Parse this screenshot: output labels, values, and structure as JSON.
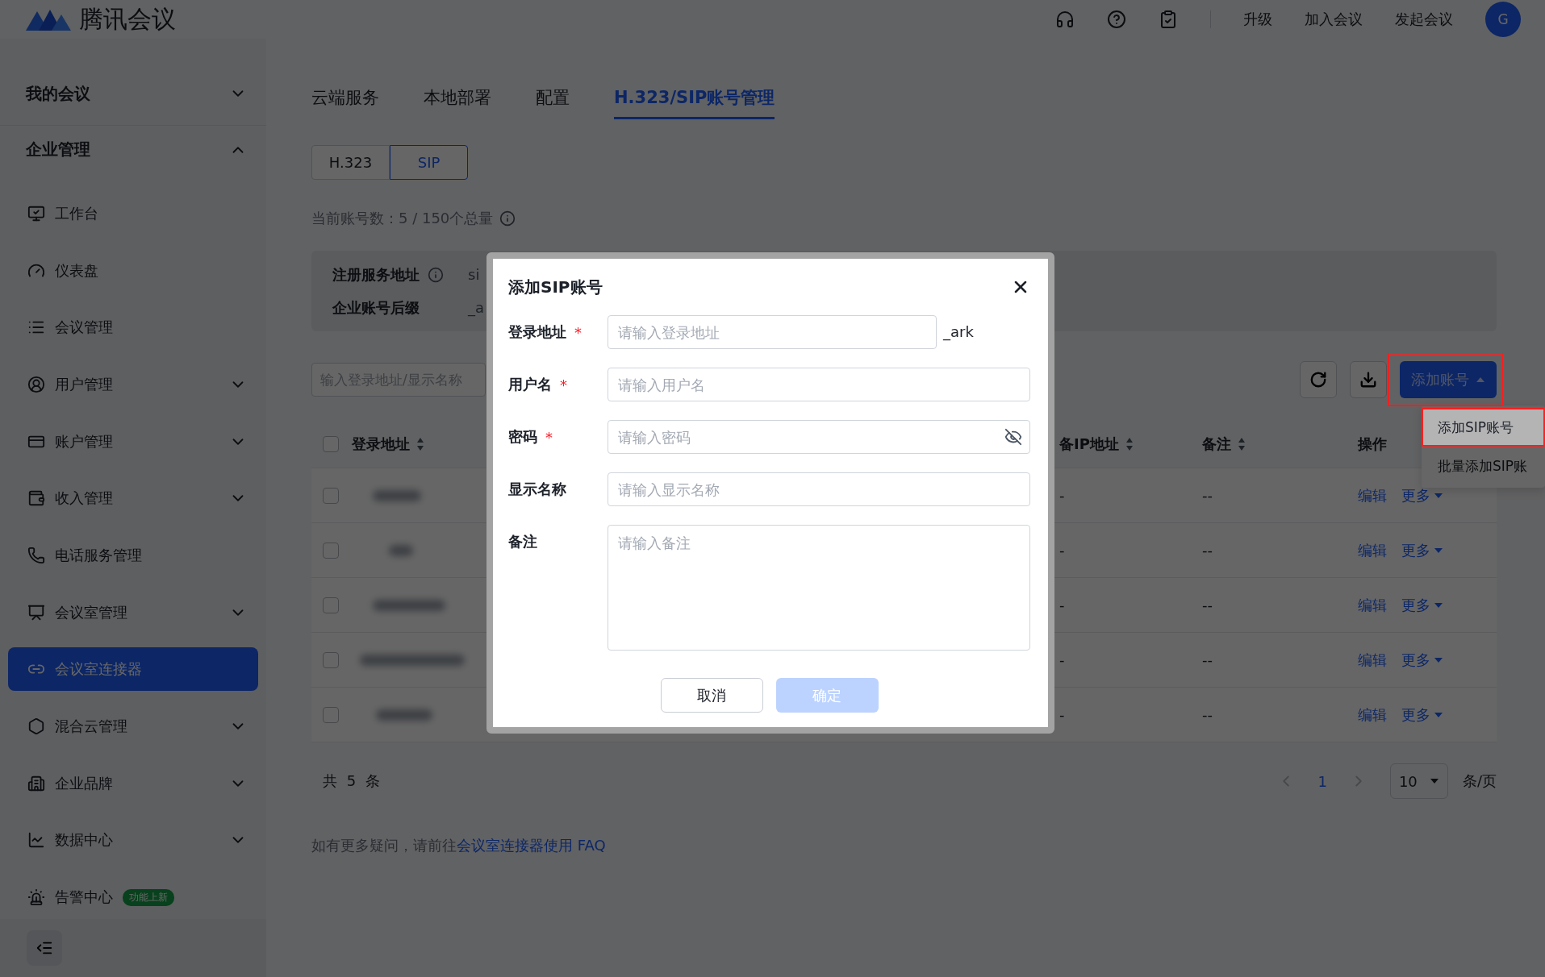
{
  "header": {
    "brand": "腾讯会议",
    "links": [
      "升级",
      "加入会议",
      "发起会议"
    ],
    "avatar": "G"
  },
  "sidebar": {
    "groups": [
      {
        "label": "我的会议",
        "expanded": false
      },
      {
        "label": "企业管理",
        "expanded": true,
        "items": [
          {
            "label": "工作台",
            "kind": "link",
            "selected": false
          },
          {
            "label": "仪表盘",
            "kind": "link",
            "selected": false
          },
          {
            "label": "会议管理",
            "kind": "link",
            "selected": false
          },
          {
            "label": "用户管理",
            "kind": "group",
            "selected": false
          },
          {
            "label": "账户管理",
            "kind": "group",
            "selected": false
          },
          {
            "label": "收入管理",
            "kind": "group",
            "selected": false
          },
          {
            "label": "电话服务管理",
            "kind": "link",
            "selected": false
          },
          {
            "label": "会议室管理",
            "kind": "group",
            "selected": false
          },
          {
            "label": "会议室连接器",
            "kind": "link",
            "selected": true
          },
          {
            "label": "混合云管理",
            "kind": "group",
            "selected": false
          },
          {
            "label": "企业品牌",
            "kind": "group",
            "selected": false
          },
          {
            "label": "数据中心",
            "kind": "group",
            "selected": false
          },
          {
            "label": "告警中心",
            "kind": "link",
            "selected": false,
            "badge": "功能上新"
          }
        ]
      }
    ]
  },
  "tabs": [
    {
      "label": "云端服务",
      "selected": false
    },
    {
      "label": "本地部署",
      "selected": false
    },
    {
      "label": "配置",
      "selected": false
    },
    {
      "label": "H.323/SIP账号管理",
      "selected": true
    }
  ],
  "segments": [
    {
      "label": "H.323",
      "selected": false
    },
    {
      "label": "SIP",
      "selected": true
    }
  ],
  "account_count": "当前账号数：5 / 150个总量",
  "info": [
    {
      "label": "注册服务地址",
      "value": "si",
      "hint": true
    },
    {
      "label": "企业账号后缀",
      "value": "_a",
      "hint": false
    }
  ],
  "search": {
    "placeholder": "输入登录地址/显示名称"
  },
  "add_button": {
    "label": "添加账号",
    "highlighted": true
  },
  "add_menu": [
    {
      "label": "添加SIP账号",
      "selected": true
    },
    {
      "label": "批量添加SIP账",
      "selected": false
    }
  ],
  "table": {
    "select_all": {
      "checked": false
    },
    "columns": [
      {
        "label": "登录地址",
        "sortable": true
      },
      {
        "label": "备IP地址",
        "sortable": true
      },
      {
        "label": "备注",
        "sortable": true
      },
      {
        "label": "操作",
        "sortable": false
      }
    ],
    "rows": [
      {
        "checked": false,
        "ip": "-",
        "remark": "--",
        "actions": [
          "编辑",
          "更多"
        ]
      },
      {
        "checked": false,
        "ip": "-",
        "remark": "--",
        "actions": [
          "编辑",
          "更多"
        ]
      },
      {
        "checked": false,
        "ip": "-",
        "remark": "--",
        "actions": [
          "编辑",
          "更多"
        ]
      },
      {
        "checked": false,
        "ip": "-",
        "remark": "--",
        "actions": [
          "编辑",
          "更多"
        ]
      },
      {
        "checked": false,
        "ip": "-",
        "remark": "--",
        "actions": [
          "编辑",
          "更多"
        ]
      }
    ]
  },
  "total": "共 5 条",
  "pagination": {
    "pages": [
      {
        "label": "1",
        "selected": true
      }
    ],
    "page_size": "10",
    "unit": "条/页"
  },
  "help": {
    "text": "如有更多疑问，请前往",
    "link": "会议室连接器使用 FAQ"
  },
  "modal": {
    "title": "添加SIP账号",
    "required_mark": "*",
    "fields": [
      {
        "label": "登录地址",
        "required": true,
        "kind": "text",
        "placeholder": "请输入登录地址",
        "suffix": "_ark"
      },
      {
        "label": "用户名",
        "required": true,
        "kind": "text",
        "placeholder": "请输入用户名"
      },
      {
        "label": "密码",
        "required": true,
        "kind": "password",
        "placeholder": "请输入密码"
      },
      {
        "label": "显示名称",
        "required": false,
        "kind": "text",
        "placeholder": "请输入显示名称"
      },
      {
        "label": "备注",
        "required": false,
        "kind": "textarea",
        "placeholder": "请输入备注"
      }
    ],
    "buttons": [
      {
        "label": "取消",
        "kind": "secondary",
        "disabled": false
      },
      {
        "label": "确定",
        "kind": "primary",
        "disabled": true
      }
    ]
  }
}
